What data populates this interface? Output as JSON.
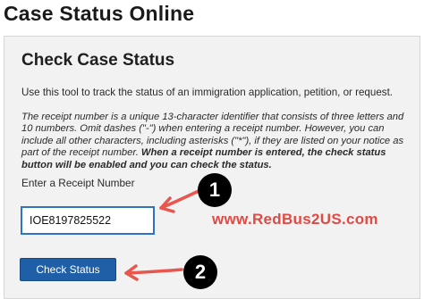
{
  "header": {
    "title": "Case Status Online"
  },
  "card": {
    "title": "Check Case Status",
    "intro": "Use this tool to track the status of an immigration application, petition, or request.",
    "note_part1": "The receipt number is a unique 13-character identifier that consists of three letters and 10 numbers. Omit dashes (\"-\") when entering a receipt number. However, you can include all other characters, including asterisks (\"*\"), if they are listed on your notice as part of the receipt number. ",
    "note_part2": "When a receipt number is entered, the check status button will be enabled and you can check the status.",
    "receipt_label": "Enter a Receipt Number",
    "receipt_value": "IOE8197825522",
    "button_label": "Check Status"
  },
  "overlay": {
    "badge_1": "1",
    "badge_2": "2",
    "watermark": "www.RedBus2US.com",
    "arrow_color": "#e8564f"
  }
}
